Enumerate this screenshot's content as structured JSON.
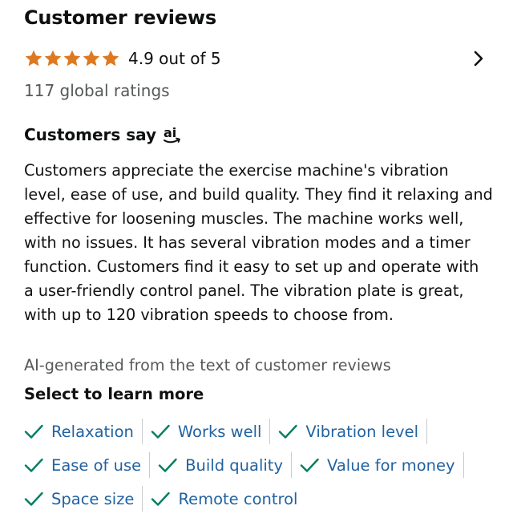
{
  "header": {
    "title": "Customer reviews"
  },
  "rating": {
    "stars_value": 4.9,
    "stars_max": 5,
    "text": "4.9 out of 5",
    "global_ratings": "117 global ratings",
    "star_color": "#de7921"
  },
  "say": {
    "title": "Customers say",
    "icon": "ai-icon"
  },
  "summary": "Customers appreciate the exercise machine's vibration level, ease of use, and build quality. They find it relaxing and effective for loosening muscles. The machine works well, with no issues. It has several vibration modes and a timer function. Customers find it easy to set up and operate with a user-friendly control panel. The vibration plate is great, with up to 120 vibration speeds to choose from.",
  "ai_note": "AI-generated from the text of customer reviews",
  "learn_more": {
    "title": "Select to learn more",
    "check_color": "#067d62",
    "link_color": "#2162a1",
    "rows": [
      [
        "Relaxation",
        "Works well",
        "Vibration level"
      ],
      [
        "Ease of use",
        "Build quality",
        "Value for money"
      ],
      [
        "Space size",
        "Remote control"
      ]
    ]
  }
}
